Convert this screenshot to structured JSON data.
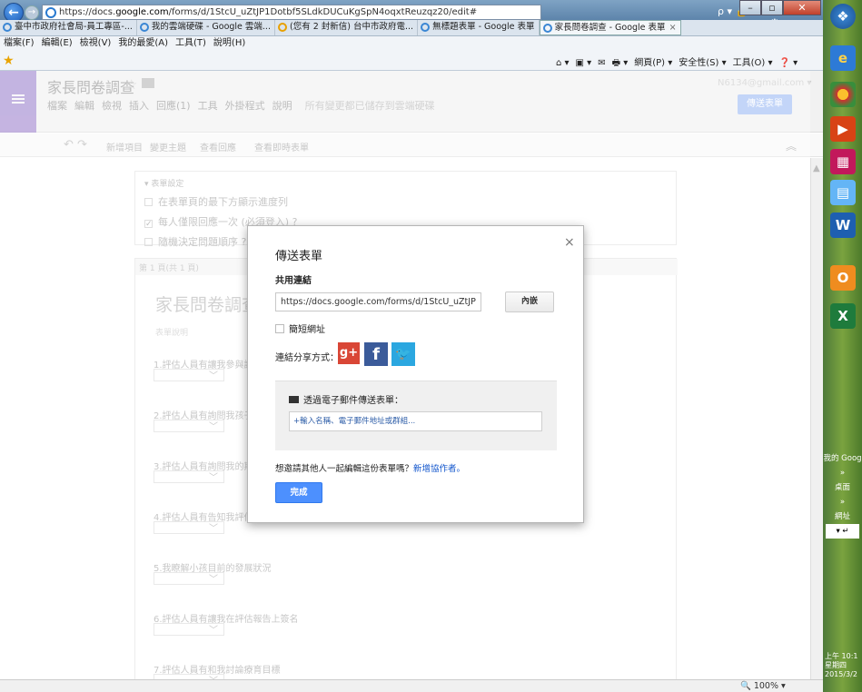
{
  "browser": {
    "url_prefix": "https://docs.",
    "url_domain": "google.com",
    "url_rest": "/forms/d/1StcU_uZtJP1Dotbf5SLdkDUCuKgSpN4oqxtReuzqz20/edit#",
    "addr_controls": "ρ ▾ 🔒 ↻",
    "home_icons": "⌂ ★ ⚙",
    "tabs": [
      {
        "label": "臺中市政府社會局-員工專區-..."
      },
      {
        "label": "我的雲端硬碟 - Google 雲端..."
      },
      {
        "label": "(您有 2 封新信) 台中市政府電..."
      },
      {
        "label": "無標題表單 - Google 表單"
      },
      {
        "label": "家長問卷調查 - Google 表單",
        "close": "×"
      }
    ],
    "menu": [
      "檔案(F)",
      "編輯(E)",
      "檢視(V)",
      "我的最愛(A)",
      "工具(T)",
      "說明(H)"
    ],
    "commands": [
      "⌂ ▾",
      "▣ ▾",
      "✉",
      "🖶 ▾",
      "網頁(P) ▾",
      "安全性(S) ▾",
      "工具(O) ▾",
      "❓ ▾"
    ],
    "zoom": "🔍 100%  ▾"
  },
  "docs": {
    "title": "家長問卷調查",
    "menus": [
      "檔案",
      "編輯",
      "檢視",
      "插入",
      "回應(1)",
      "工具",
      "外掛程式",
      "說明"
    ],
    "saved_msg": "所有變更都已儲存到雲端硬碟",
    "account": "N6134@gmail.com ▾",
    "send_form": "傳送表單",
    "toolbar": {
      "undo": "↶ ↷",
      "add_item": "新增項目",
      "change_theme": "變更主題",
      "view_responses": "查看回應",
      "view_live": "查看即時表單",
      "collapse": "︽"
    }
  },
  "settings": {
    "label": "▾ 表單設定",
    "options": [
      {
        "text": "在表單頁的最下方顯示進度列",
        "checked": ""
      },
      {
        "text": "每人僅限回應一次 (必須登入) ?",
        "checked": "✓"
      },
      {
        "text": "隨機決定問題順序 ?",
        "checked": ""
      }
    ]
  },
  "form": {
    "page_label": "第 1 頁(共 1 頁)",
    "title": "家長問卷調查",
    "description": "表單說明",
    "questions": [
      "1.評估人員有讓我參與評估",
      "2.評估人員有詢問我孩子",
      "3.評估人員有詢問我的期",
      "4.評估人員有告知我評估",
      "5.我瞭解小孩目前的發展狀況",
      "6.評估人員有讓我在評估報告上簽名",
      "7.評估人員有和我討論療育目標"
    ]
  },
  "dialog": {
    "title": "傳送表單",
    "close": "×",
    "link_label": "共用連結",
    "link_value": "https://docs.google.com/forms/d/1StcU_uZtJP1Dc",
    "embed": "內嵌",
    "short_url": "簡短網址",
    "share_label": "連結分享方式：",
    "share": {
      "gplus": "g+",
      "facebook": "f",
      "twitter": "🐦"
    },
    "email_label": "透過電子郵件傳送表單：",
    "email_placeholder": "+輸入名稱、電子郵件地址或群組...",
    "collab_q": "想邀請其他人一起編輯這份表單嗎？",
    "collab_link": "新增協作者。",
    "done": "完成"
  },
  "taskbar": {
    "side": [
      "我的 Goog",
      "»",
      "桌面",
      "»",
      "網址",
      "▾ ↵"
    ],
    "tray": [
      "上午 10:1",
      "星期四",
      "2015/3/2"
    ]
  }
}
